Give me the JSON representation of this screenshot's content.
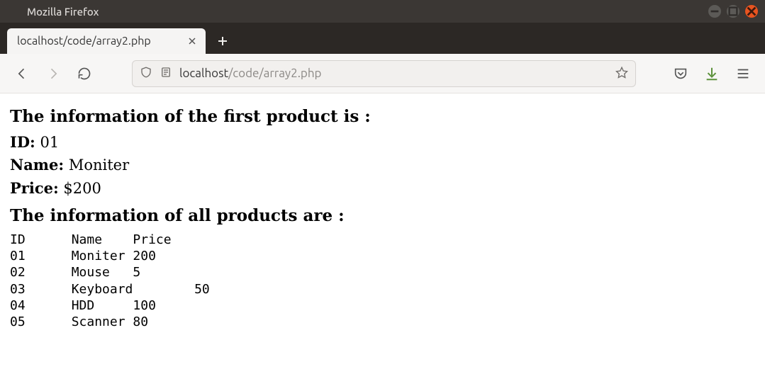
{
  "window": {
    "title": "Mozilla Firefox"
  },
  "tab": {
    "label": "localhost/code/array2.php"
  },
  "url": {
    "host": "localhost",
    "path": "/code/array2.php"
  },
  "page": {
    "heading1": "The information of the first product is :",
    "first": {
      "id_label": "ID:",
      "id_value": "01",
      "name_label": "Name:",
      "name_value": "Moniter",
      "price_label": "Price:",
      "price_value": "$200"
    },
    "heading2": "The information of all products are :",
    "table_text": "ID\tName\tPrice\n01\tMoniter\t200\n02\tMouse\t5\n03\tKeyboard\t50\n04\tHDD\t100\n05\tScanner\t80"
  }
}
